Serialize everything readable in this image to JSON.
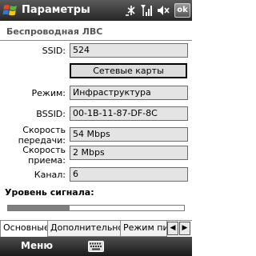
{
  "titlebar": {
    "title": "Параметры",
    "ok_label": "ok"
  },
  "section": {
    "title": "Беспроводная ЛВС"
  },
  "fields": {
    "ssid_label": "SSID:",
    "ssid_value": "524",
    "cards_button": "Сетевые карты",
    "mode_label": "Режим:",
    "mode_value": "Инфраструктура",
    "bssid_label": "BSSID:",
    "bssid_value": "00-1B-11-87-DF-8C",
    "tx_label_1": "Скорость",
    "tx_label_2": "передачи:",
    "tx_value": "54 Mbps",
    "rx_label_1": "Скорость",
    "rx_label_2": "приема:",
    "rx_value": "2 Mbps",
    "channel_label": "Канал:",
    "channel_value": "6"
  },
  "signal": {
    "label": "Уровень сигнала:",
    "level": 0.35
  },
  "tabs": [
    {
      "label": "Основные",
      "active": true
    },
    {
      "label": "Дополнительно",
      "active": false
    },
    {
      "label": "Режим пит",
      "active": false
    }
  ],
  "bottombar": {
    "menu_label": "Меню"
  },
  "icons": [
    "windows-start-icon",
    "connectivity-icon",
    "signal-strength-icon",
    "volume-mute-icon",
    "keyboard-icon",
    "chevron-left-icon",
    "chevron-right-icon"
  ]
}
